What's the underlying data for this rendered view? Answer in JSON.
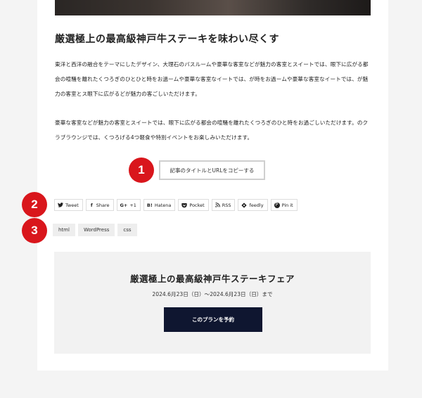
{
  "article": {
    "title": "厳選極上の最高級神戸牛ステーキを味わい尽くす",
    "paragraphs": [
      "東洋と西洋の融合をテーマにしたデザイン、大理石のバスルームや豪華な客室などが魅力の客室とスイートでは、眼下に広がる都会の喧騒を離れたくつろぎのひとひと時をお過ームや豪華な客室なイートでは、が時をお過ームや豪華な客室なイートでは、が魅力の客室とス眼下に広がるどが魅力の客ごしいただけます。",
      "豪華な客室などが魅力の客室とスイートでは、眼下に広がる都会の喧騒を離れたくつろぎのひと時をお過ごしいただけます。のクラブラウンジでは、くつろげる4つ軽食や特別イベントをお楽しみいただけます。"
    ]
  },
  "copy_button_label": "記事のタイトルとURLをコピーする",
  "badges": [
    "1",
    "2",
    "3"
  ],
  "share_buttons": [
    {
      "icon": "twitter-icon",
      "glyph": "🐦",
      "label": "Tweet"
    },
    {
      "icon": "facebook-icon",
      "glyph": "f",
      "label": "Share"
    },
    {
      "icon": "google-plus-icon",
      "glyph": "G+",
      "label": "+1"
    },
    {
      "icon": "hatena-icon",
      "glyph": "B!",
      "label": "Hatena"
    },
    {
      "icon": "pocket-icon",
      "glyph": "⛉",
      "label": "Pocket"
    },
    {
      "icon": "rss-icon",
      "glyph": "◜",
      "label": "RSS"
    },
    {
      "icon": "feedly-icon",
      "glyph": "◈",
      "label": "feedly"
    },
    {
      "icon": "pinterest-icon",
      "glyph": "P",
      "label": "Pin it"
    }
  ],
  "tags": [
    "html",
    "WordPress",
    "css"
  ],
  "promo": {
    "title": "厳選極上の最高級神戸牛ステーキフェア",
    "date": "2024.6月23日（日）～2024.6月23日（日）まで",
    "button_label": "このプランを予約"
  },
  "colors": {
    "badge": "#d9161c",
    "reserve_button": "#0f1630",
    "page_background": "#f4f4f4",
    "promo_background": "#f2f2f2"
  }
}
